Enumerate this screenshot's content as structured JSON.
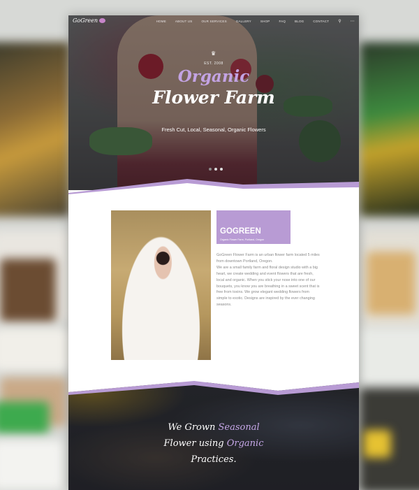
{
  "logo": {
    "text": "GoGreen"
  },
  "nav": {
    "items": [
      "HOME",
      "ABOUT US",
      "OUR SERVICES",
      "GALLERY",
      "SHOP",
      "FAQ",
      "BLOG",
      "CONTACT"
    ]
  },
  "hero": {
    "est": "EST. 2008",
    "title_line1": "Organic",
    "title_line2": "Flower Farm",
    "tagline": "Fresh Cut, Local, Seasonal, Organic Flowers"
  },
  "about": {
    "title": "GOGREEN",
    "subtitle": "Organic Flower Farm, Portland, Oregon",
    "paragraph1": "GoGreen Flower Farm is an urban flower farm located 5 miles from downtown Portland, Oregon.",
    "paragraph2": "We are a small family farm and floral design studio with a big heart, we create wedding and event flowers that are fresh, local and organic. When you stick your nose into one of our bouquets, you know you are breathing in a sweet scent that is free from toxins. We grow elegant wedding flowers from simple to exotic. Designs are inspired by the ever changing seasons."
  },
  "quote": {
    "line1_a": "We Grown ",
    "line1_b": "Seasonal",
    "line2_a": "Flower using ",
    "line2_b": "Organic",
    "line3": "Practices."
  },
  "colors": {
    "accent_purple": "#b89bd4",
    "title_purple": "#c3a3e3",
    "body_text": "#8b8b8b"
  },
  "icons": {
    "search": "search-icon",
    "menu": "menu-dots-icon",
    "crest": "crown-icon"
  }
}
